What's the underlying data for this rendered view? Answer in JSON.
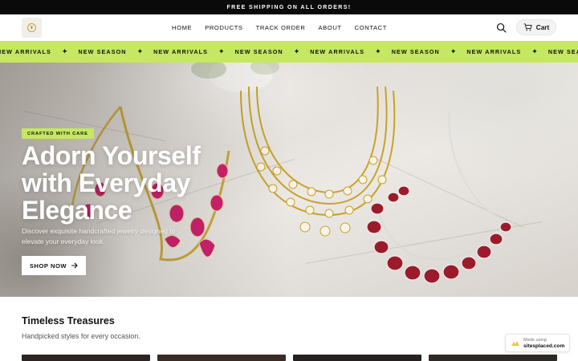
{
  "announcement": {
    "text": "FREE SHIPPING ON ALL ORDERS!"
  },
  "header": {
    "nav": [
      {
        "label": "HOME"
      },
      {
        "label": "PRODUCTS"
      },
      {
        "label": "TRACK ORDER"
      },
      {
        "label": "ABOUT"
      },
      {
        "label": "CONTACT"
      }
    ],
    "cart_label": "Cart",
    "search_icon": "search-icon",
    "cart_icon": "cart-icon"
  },
  "marquee": {
    "items": [
      "NEW ARRIVALS",
      "NEW SEASON",
      "NEW ARRIVALS",
      "NEW SEASON",
      "NEW ARRIVALS",
      "NEW SEASON",
      "NEW ARRIVALS",
      "NEW SEASON"
    ],
    "separator": "✦",
    "color": "#c6e762"
  },
  "hero": {
    "badge": "CRAFTED WITH CARE",
    "headline": "Adorn Yourself with Everyday Elegance",
    "subtext": "Discover exquisite handcrafted jewelry designed to elevate your everyday look.",
    "cta_label": "SHOP NOW"
  },
  "section": {
    "title": "Timeless Treasures",
    "subtitle": "Handpicked styles for every occasion."
  },
  "made_using": {
    "line1": "Made using",
    "line2": "sitesplaced.com"
  },
  "colors": {
    "accent": "#c6e762",
    "announcement_bg": "#0a0a0a",
    "ruby": "#9c1b2a",
    "pink_stone": "#d0206f",
    "gold": "#c9a227"
  }
}
